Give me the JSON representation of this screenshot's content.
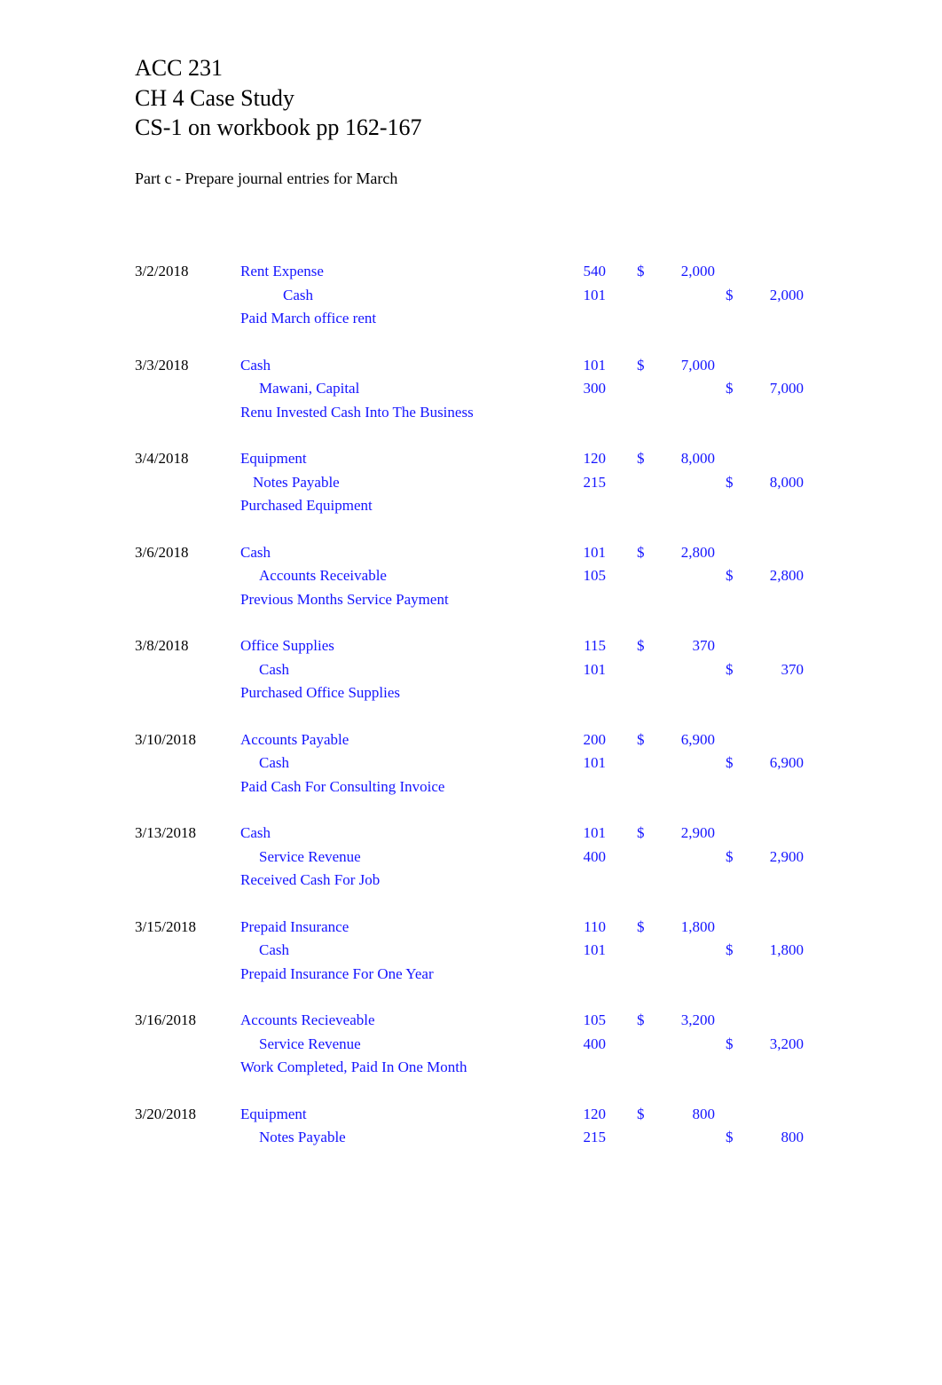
{
  "document": {
    "title_lines": [
      "ACC 231",
      "CH 4 Case Study",
      "CS-1 on workbook pp 162-167"
    ],
    "subtitle": "Part c - Prepare journal entries for March",
    "text_color": "#000000",
    "entry_color": "#1414ff",
    "background": "#ffffff"
  },
  "journal": {
    "entries": [
      {
        "date": "3/2/2018",
        "debit": {
          "account": "Rent Expense",
          "indent": 271,
          "acct_no": "540",
          "currency": "$",
          "amount": "2,000"
        },
        "credit": {
          "account": "Cash",
          "indent": 319,
          "acct_no": "101",
          "currency": "$",
          "amount": "2,000"
        },
        "memo": "Paid March office rent"
      },
      {
        "date": "3/3/2018",
        "debit": {
          "account": "Cash",
          "indent": 271,
          "acct_no": "101",
          "currency": "$",
          "amount": "7,000"
        },
        "credit": {
          "account": "Mawani, Capital",
          "indent": 292,
          "acct_no": "300",
          "currency": "$",
          "amount": "7,000"
        },
        "memo": "Renu Invested Cash Into The Business"
      },
      {
        "date": "3/4/2018",
        "debit": {
          "account": "Equipment",
          "indent": 271,
          "acct_no": "120",
          "currency": "$",
          "amount": "8,000"
        },
        "credit": {
          "account": "Notes Payable",
          "indent": 285,
          "acct_no": "215",
          "currency": "$",
          "amount": "8,000"
        },
        "memo": "Purchased Equipment"
      },
      {
        "date": "3/6/2018",
        "debit": {
          "account": "Cash",
          "indent": 271,
          "acct_no": "101",
          "currency": "$",
          "amount": "2,800"
        },
        "credit": {
          "account": "Accounts Receivable",
          "indent": 292,
          "acct_no": "105",
          "currency": "$",
          "amount": "2,800"
        },
        "memo": "Previous Months Service Payment"
      },
      {
        "date": "3/8/2018",
        "debit": {
          "account": "Office Supplies",
          "indent": 271,
          "acct_no": "115",
          "currency": "$",
          "amount": "370"
        },
        "credit": {
          "account": "Cash",
          "indent": 292,
          "acct_no": "101",
          "currency": "$",
          "amount": "370"
        },
        "memo": "Purchased Office Supplies"
      },
      {
        "date": "3/10/2018",
        "debit": {
          "account": "Accounts Payable",
          "indent": 271,
          "acct_no": "200",
          "currency": "$",
          "amount": "6,900"
        },
        "credit": {
          "account": "Cash",
          "indent": 292,
          "acct_no": "101",
          "currency": "$",
          "amount": "6,900"
        },
        "memo": "Paid Cash For Consulting Invoice"
      },
      {
        "date": "3/13/2018",
        "debit": {
          "account": "Cash",
          "indent": 271,
          "acct_no": "101",
          "currency": "$",
          "amount": "2,900"
        },
        "credit": {
          "account": "Service Revenue",
          "indent": 292,
          "acct_no": "400",
          "currency": "$",
          "amount": "2,900"
        },
        "memo": "Received Cash For Job"
      },
      {
        "date": "3/15/2018",
        "debit": {
          "account": "Prepaid Insurance",
          "indent": 271,
          "acct_no": "110",
          "currency": "$",
          "amount": "1,800"
        },
        "credit": {
          "account": "Cash",
          "indent": 292,
          "acct_no": "101",
          "currency": "$",
          "amount": "1,800"
        },
        "memo": "Prepaid Insurance For One Year"
      },
      {
        "date": "3/16/2018",
        "debit": {
          "account": "Accounts Recieveable",
          "indent": 271,
          "acct_no": "105",
          "currency": "$",
          "amount": "3,200"
        },
        "credit": {
          "account": "Service Revenue",
          "indent": 292,
          "acct_no": "400",
          "currency": "$",
          "amount": "3,200"
        },
        "memo": "Work Completed, Paid In One Month"
      },
      {
        "date": "3/20/2018",
        "debit": {
          "account": "Equipment",
          "indent": 271,
          "acct_no": "120",
          "currency": "$",
          "amount": "800"
        },
        "credit": {
          "account": "Notes Payable",
          "indent": 292,
          "acct_no": "215",
          "currency": "$",
          "amount": "800"
        },
        "memo": ""
      }
    ]
  }
}
